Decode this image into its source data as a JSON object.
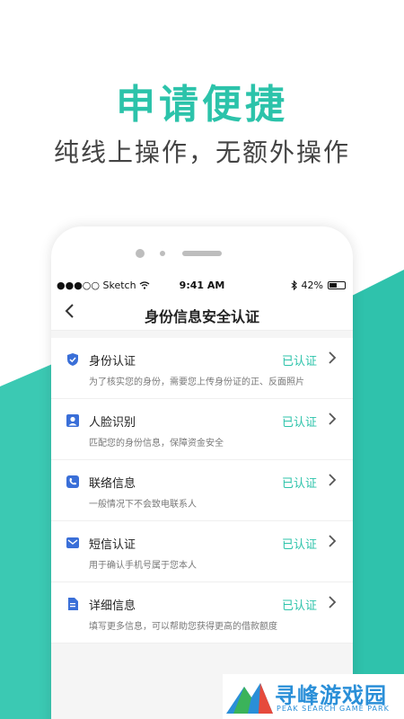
{
  "promo": {
    "headline": "申请便捷",
    "subline": "纯线上操作，无额外操作"
  },
  "statusbar": {
    "carrier": "●●●○○ Sketch",
    "time": "9:41 AM",
    "battery": "42%"
  },
  "navbar": {
    "title": "身份信息安全认证"
  },
  "items": [
    {
      "title": "身份认证",
      "desc": "为了核实您的身份，需要您上传身份证的正、反面照片",
      "status": "已认证",
      "icon": "shield-icon"
    },
    {
      "title": "人脸识别",
      "desc": "匹配您的身份信息，保障资金安全",
      "status": "已认证",
      "icon": "person-icon"
    },
    {
      "title": "联络信息",
      "desc": "一般情况下不会致电联系人",
      "status": "已认证",
      "icon": "phone-icon"
    },
    {
      "title": "短信认证",
      "desc": "用于确认手机号属于您本人",
      "status": "已认证",
      "icon": "mail-icon"
    },
    {
      "title": "详细信息",
      "desc": "填写更多信息，可以帮助您获得更高的借款额度",
      "status": "已认证",
      "icon": "document-icon"
    }
  ],
  "watermark": {
    "title": "寻峰游戏园",
    "sub": "PEAK SEARCH GAME PARK"
  },
  "colors": {
    "accent": "#2cc3aa",
    "icon": "#3a6fd8"
  }
}
